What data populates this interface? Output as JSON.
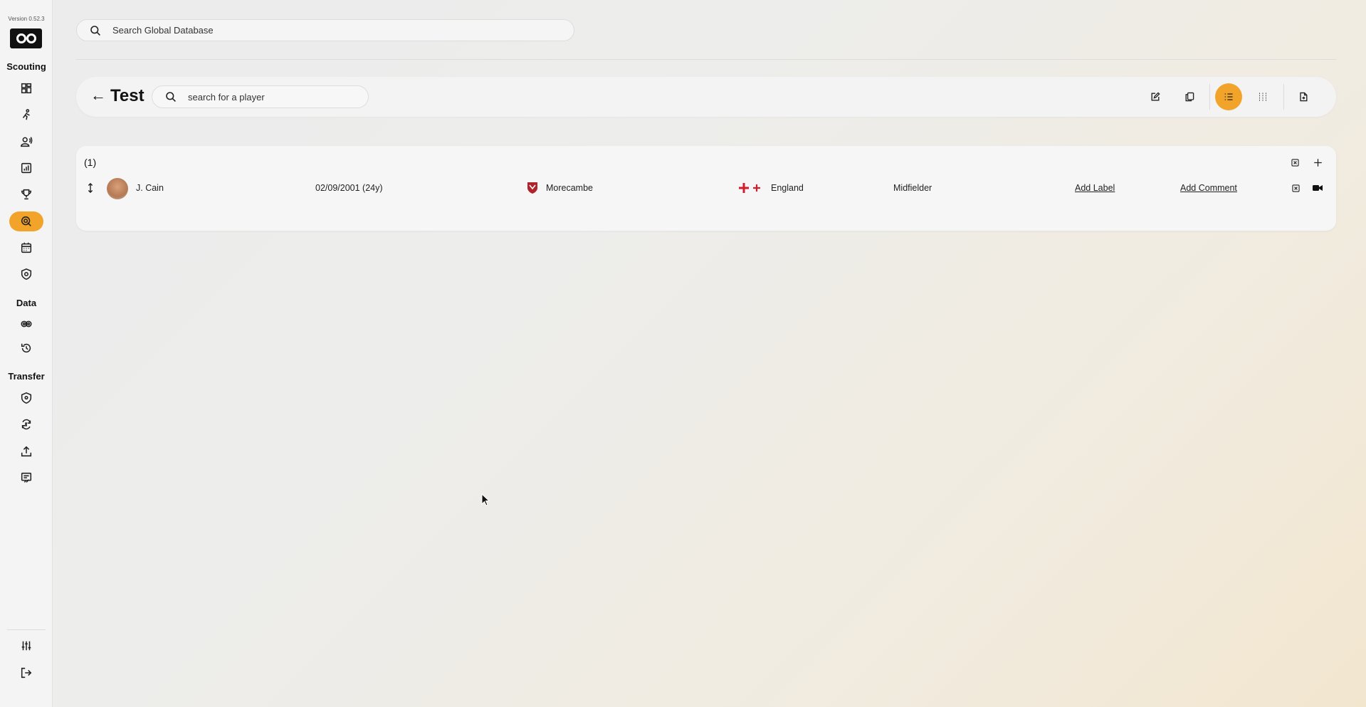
{
  "sidebar": {
    "version": "Version 0.52.3",
    "sections": {
      "scouting": "Scouting",
      "data": "Data",
      "transfer": "Transfer"
    },
    "active_item": "shadow-team",
    "accent_color": "#f2a42a"
  },
  "global_search": {
    "placeholder": "Search Global Database"
  },
  "header": {
    "back_glyph": "←",
    "title": "Test",
    "player_search_placeholder": "search for a player",
    "active_view": "list"
  },
  "list": {
    "count": "(1)",
    "rows": [
      {
        "name": "J. Cain",
        "dob": "02/09/2001 (24y)",
        "club": "Morecambe",
        "nationality": "England",
        "position": "Midfielder",
        "label_action": "Add Label",
        "comment_action": "Add Comment"
      }
    ]
  }
}
